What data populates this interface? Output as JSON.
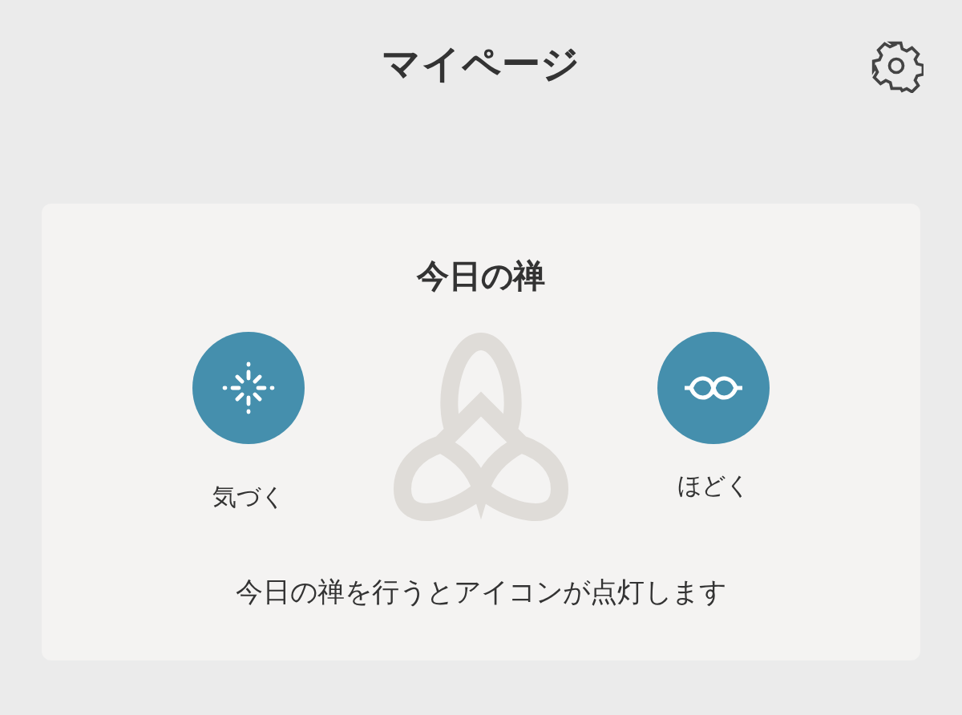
{
  "header": {
    "title": "マイページ"
  },
  "card": {
    "title": "今日の禅",
    "items": [
      {
        "label": "気づく",
        "kind": "sparkle",
        "lit": true
      },
      {
        "label": "ほどく",
        "kind": "knot",
        "lit": true
      }
    ],
    "note": "今日の禅を行うとアイコンが点灯します"
  }
}
